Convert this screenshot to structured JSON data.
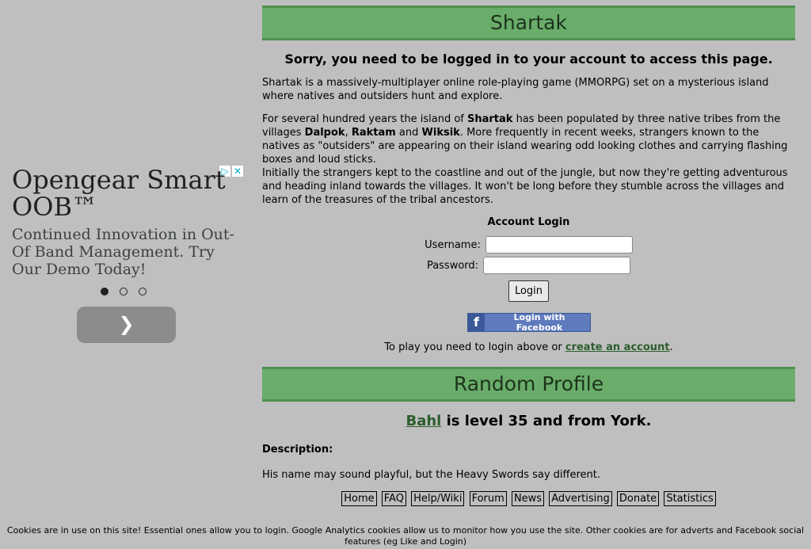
{
  "ad": {
    "title": "Opengear Smart OOB™",
    "text": "Continued Innovation in Out-Of Band Management. Try Our Demo Today!",
    "choices_icon": "adchoices-icon",
    "next_icon": "chevron-right-icon"
  },
  "header": {
    "title": "Shartak"
  },
  "notice": "Sorry, you need to be logged in to your account to access this page.",
  "intro": "Shartak is a massively-multiplayer online role-playing game (MMORPG) set on a mysterious island where natives and outsiders hunt and explore.",
  "story": {
    "part1": "For several hundred years the island of ",
    "shartak": "Shartak",
    "part2": " has been populated by three native tribes from the villages ",
    "dalpok": "Dalpok",
    "sep1": ", ",
    "raktam": "Raktam",
    "sep2": " and ",
    "wiksik": "Wiksik",
    "part3": ". More frequently in recent weeks, strangers known to the natives as \"outsiders\" are appearing on their island wearing odd looking clothes and carrying flashing boxes and loud sticks.",
    "part4": "Initially the strangers kept to the coastline and out of the jungle, but now they're getting adventurous and heading inland towards the villages. It won't be long before they stumble across the villages and learn of the treasures of the tribal ancestors."
  },
  "login": {
    "title": "Account Login",
    "username_label": "Username:",
    "password_label": "Password:",
    "username_value": "",
    "password_value": "",
    "button": "Login",
    "facebook_button": "Login with Facebook",
    "play_prefix": "To play you need to login above or ",
    "create_link": "create an account",
    "play_suffix": "."
  },
  "profile": {
    "header": "Random Profile",
    "name": "Bahl",
    "info": " is level 35 and from York.",
    "desc_label": "Description:",
    "description": "His name may sound playful, but the Heavy Swords say different."
  },
  "nav": [
    "Home",
    "FAQ",
    "Help/Wiki",
    "Forum",
    "News",
    "Advertising",
    "Donate",
    "Statistics"
  ],
  "cookies": "Cookies are in use on this site! Essential ones allow you to login. Google Analytics cookies allow us to monitor how you use the site. Other cookies are for adverts and Facebook social features (eg Like and Login)"
}
